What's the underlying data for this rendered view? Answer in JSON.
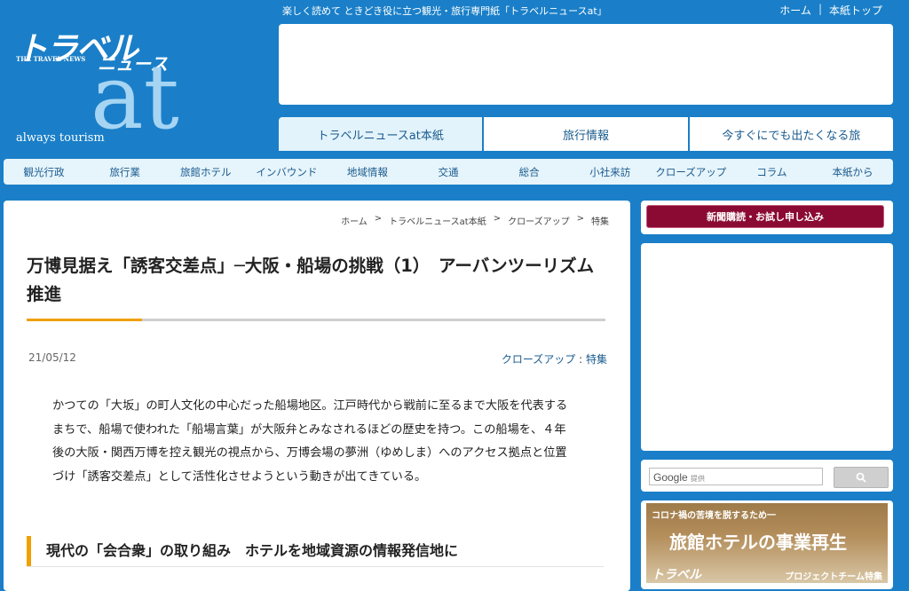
{
  "header": {
    "logo": {
      "text_jp": "トラベル",
      "text_news": "ニュース",
      "text_en": "THE TRAVEL NEWS",
      "text_at": "at",
      "text_always": "always tourism"
    },
    "tagline": "楽しく読めて ときどき役に立つ観光・旅行専門紙「トラベルニュースat」",
    "toplinks": [
      "ホーム",
      "本紙トップ"
    ],
    "toplinks_sep": "|"
  },
  "subnav": {
    "tabs": [
      {
        "label": "トラベルニュースat本紙"
      },
      {
        "label": "旅行情報"
      },
      {
        "label": "今すぐにでも出たくなる旅"
      }
    ]
  },
  "mainnav": {
    "items": [
      {
        "label": "観光行政"
      },
      {
        "label": "旅行業"
      },
      {
        "label": "旅館ホテル"
      },
      {
        "label": "インバウンド"
      },
      {
        "label": "地域情報"
      },
      {
        "label": "交通"
      },
      {
        "label": "総合"
      },
      {
        "label": "小社来訪"
      },
      {
        "label": "クローズアップ"
      },
      {
        "label": "コラム"
      },
      {
        "label": "本紙から"
      }
    ]
  },
  "breadcrumb": {
    "items": [
      "ホーム",
      "トラベルニュースat本紙",
      "クローズアップ",
      "特集"
    ],
    "sep": ">"
  },
  "article": {
    "title": "万博見据え「誘客交差点」─大阪・船場の挑戦（1）　アーバンツーリズム推進",
    "date": "21/05/12",
    "category1": "クローズアップ",
    "category_sep": ":",
    "category2": "特集",
    "body": "かつての「大坂」の町人文化の中心だった船場地区。江戸時代から戦前に至るまで大阪を代表するまちで、船場で使われた「船場言葉」が大阪弁とみなされるほどの歴史を持つ。この船場を、４年後の大阪・関西万博を控え観光の視点から、万博会場の夢洲（ゆめしま）へのアクセス拠点と位置づけ「誘客交差点」として活性化させようという動きが出てきている。",
    "heading": "現代の「会合衆」の取り組み　ホテルを地域資源の情報発信地に"
  },
  "sidebar": {
    "subscribe_label": "新聞購読・お試し申し込み",
    "search": {
      "google": "Google",
      "provided": "提供"
    },
    "banner": {
      "line1": "コロナ禍の苦境を脱するため一",
      "line2": "旅館ホテルの事業再生",
      "line3": "トラベル",
      "line4": "プロジェクトチーム特集"
    }
  },
  "colors": {
    "brand_blue": "#1a7fc8",
    "accent_orange": "#f0a000",
    "subscribe_red": "#8b0a33",
    "link_blue": "#1a5b8e"
  }
}
